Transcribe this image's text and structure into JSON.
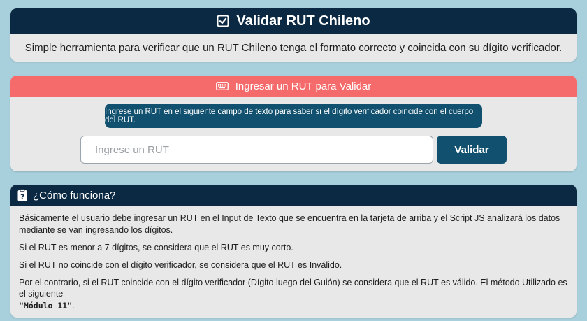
{
  "title_card": {
    "title": "Validar RUT Chileno",
    "title_icon": "check-square-icon",
    "subtitle": "Simple herramienta para verificar que un RUT Chileno tenga el formato correcto y coincida con su dígito verificador."
  },
  "form_card": {
    "header": "Ingresar un RUT para Validar",
    "header_icon": "keyboard-icon",
    "info": "Ingrese un RUT en el siguiente campo de texto para saber si el dígito verificador coincide con el cuerpo del RUT.",
    "input_placeholder": "Ingrese un RUT",
    "input_value": "",
    "button_label": "Validar"
  },
  "how_card": {
    "header": "¿Cómo funciona?",
    "header_icon": "clipboard-question-icon",
    "p1": "Básicamente el usuario debe ingresar un RUT en el Input de Texto que se encuentra en la tarjeta de arriba y el Script JS analizará los datos mediante se van ingresando los dígitos.",
    "p2": "Si el RUT es menor a 7 dígitos, se considera que el RUT es muy corto.",
    "p3": "Si el RUT no coincide con el dígito verificador, se considera que el RUT es Inválido.",
    "p4": "Por el contrario, si el RUT coincide con el dígito verificador (Dígito luego del Guión) se considera que el RUT es válido. El método Utilizado es el siguiente",
    "p4_method": "\"Módulo 11\"",
    "p4_end": "."
  },
  "colors": {
    "background": "#a8d0dc",
    "dark_header": "#0b2942",
    "red_header": "#f56b6b",
    "accent": "#11506e",
    "card": "#e8e8e8"
  }
}
